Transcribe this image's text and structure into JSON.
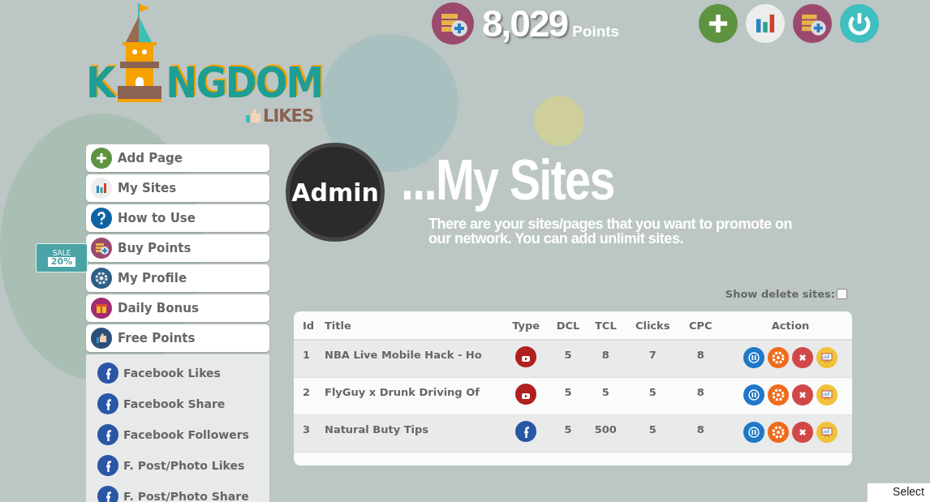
{
  "logo": {
    "letters": [
      "K",
      "NGDOM"
    ],
    "tagline": "LIKES"
  },
  "points": {
    "value": "8,029",
    "unit": "Points"
  },
  "header_buttons": [
    {
      "kind": "add"
    },
    {
      "kind": "stats"
    },
    {
      "kind": "buy"
    },
    {
      "kind": "logout"
    }
  ],
  "sale_tag": {
    "label": "SALE",
    "discount": "20%"
  },
  "sidebar": {
    "items": [
      {
        "label": "Add Page",
        "kind": "add"
      },
      {
        "label": "My Sites",
        "kind": "stats"
      },
      {
        "label": "How to Use",
        "kind": "help"
      },
      {
        "label": "Buy Points",
        "kind": "buy"
      },
      {
        "label": "My Profile",
        "kind": "gear"
      },
      {
        "label": "Daily Bonus",
        "kind": "gift"
      },
      {
        "label": "Free Points",
        "kind": "thumb",
        "expanded": true,
        "children": [
          {
            "label": "Facebook Likes",
            "kind": "facebook"
          },
          {
            "label": "Facebook Share",
            "kind": "facebook"
          },
          {
            "label": "Facebook Followers",
            "kind": "facebook"
          },
          {
            "label": "F. Post/Photo Likes",
            "kind": "facebook"
          },
          {
            "label": "F. Post/Photo Share",
            "kind": "facebook"
          }
        ]
      }
    ]
  },
  "user_badge": "Admin",
  "page_title": "...My Sites",
  "intro": "There are your sites/pages that you want to promote on our network. You can add unlimit sites.",
  "show_deleted": {
    "label": "Show delete sites:",
    "checked": false
  },
  "table": {
    "columns": [
      "Id",
      "Title",
      "Type",
      "DCL",
      "TCL",
      "Clicks",
      "CPC",
      "Action"
    ],
    "rows": [
      {
        "id": "1",
        "title": "NBA Live Mobile Hack - Ho",
        "kind": "youtube",
        "dcl": "5",
        "tcl": "8",
        "clicks": "7",
        "cpc": "8"
      },
      {
        "id": "2",
        "title": "FlyGuy x Drunk Driving Of",
        "kind": "youtube",
        "dcl": "5",
        "tcl": "5",
        "clicks": "5",
        "cpc": "8"
      },
      {
        "id": "3",
        "title": "Natural Buty Tips",
        "kind": "facebook",
        "dcl": "5",
        "tcl": "500",
        "clicks": "5",
        "cpc": "8"
      }
    ]
  },
  "select_button": "Select"
}
